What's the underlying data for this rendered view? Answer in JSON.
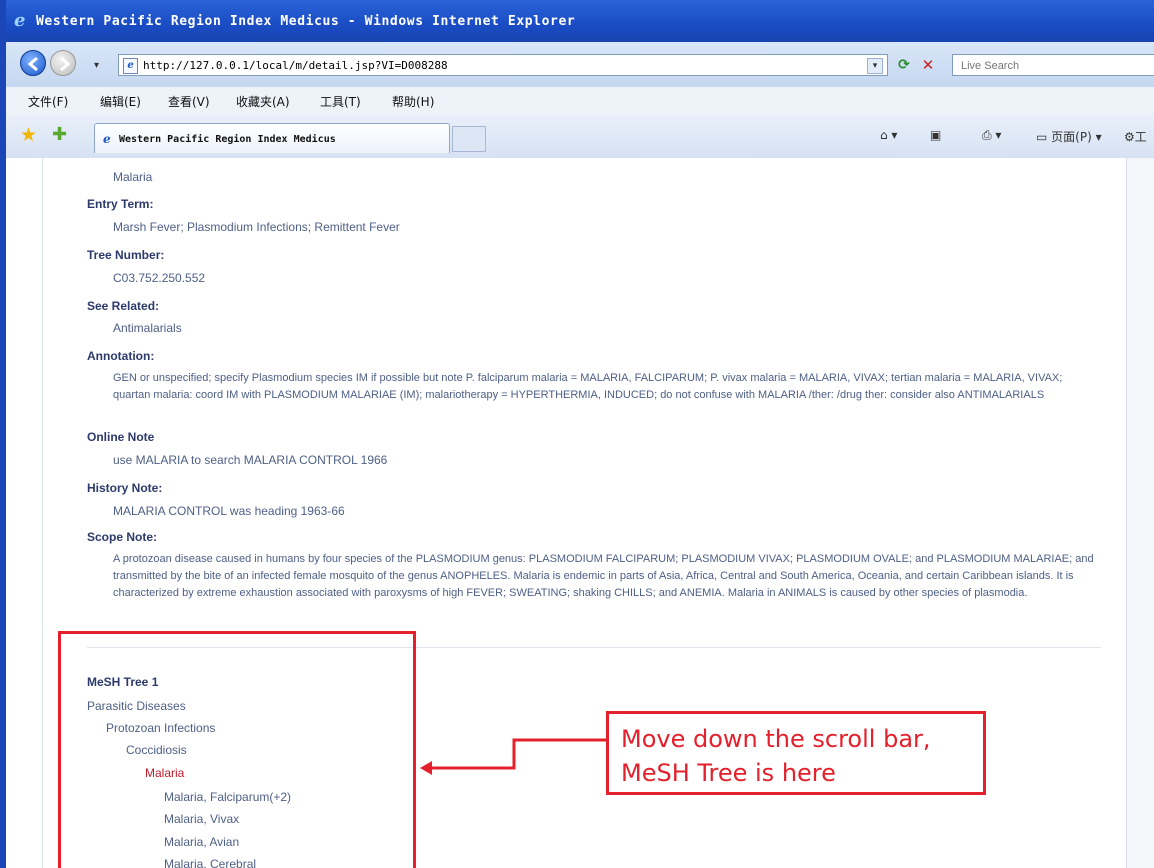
{
  "window": {
    "title": "Western Pacific Region Index Medicus - Windows Internet Explorer"
  },
  "address_bar": {
    "url": "http://127.0.0.1/local/m/detail.jsp?VI=D008288",
    "search_placeholder": "Live Search"
  },
  "menu": {
    "items": [
      "文件(F)",
      "编辑(E)",
      "查看(V)",
      "收藏夹(A)",
      "工具(T)",
      "帮助(H)"
    ]
  },
  "tabs": {
    "active_title": "Western Pacific Region Index Medicus",
    "tools": {
      "page_label": "页面(P)",
      "tools_label": "工"
    }
  },
  "record": {
    "heading_value": "Malaria",
    "entry_term_label": "Entry Term:",
    "entry_term_value": "Marsh Fever;  Plasmodium Infections;  Remittent Fever",
    "tree_number_label": "Tree Number:",
    "tree_number_value": "C03.752.250.552",
    "see_related_label": "See Related:",
    "see_related_value": "Antimalarials",
    "annotation_label": "Annotation:",
    "annotation_value": "GEN or unspecified; specify Plasmodium species IM if possible but note P. falciparum malaria = MALARIA, FALCIPARUM; P. vivax malaria = MALARIA, VIVAX; tertian malaria = MALARIA, VIVAX; quartan malaria: coord IM with PLASMODIUM MALARIAE (IM); malariotherapy = HYPERTHERMIA, INDUCED; do not confuse with MALARIA /ther: /drug ther: consider also ANTIMALARIALS",
    "online_note_label": "Online Note",
    "online_note_value": "use MALARIA to search MALARIA CONTROL 1966",
    "history_note_label": "History Note:",
    "history_note_value": "MALARIA CONTROL was heading 1963-66",
    "scope_note_label": "Scope Note:",
    "scope_note_value": "A protozoan disease caused in humans by four species of the PLASMODIUM genus: PLASMODIUM FALCIPARUM; PLASMODIUM VIVAX; PLASMODIUM OVALE; and PLASMODIUM MALARIAE; and transmitted by the bite of an infected female mosquito of the genus ANOPHELES. Malaria is endemic in parts of Asia, Africa, Central and South America, Oceania, and certain Caribbean islands. It is characterized by extreme exhaustion associated with paroxysms of high FEVER; SWEATING; shaking CHILLS; and ANEMIA. Malaria in ANIMALS is caused by other species of plasmodia."
  },
  "mesh_tree": {
    "title": "MeSH Tree 1",
    "nodes": [
      "Parasitic Diseases",
      "Protozoan Infections",
      "Coccidiosis",
      "Malaria",
      "Malaria, Falciparum(+2)",
      "Malaria, Vivax",
      "Malaria, Avian",
      "Malaria, Cerebral"
    ]
  },
  "callout": {
    "line1": "Move down the scroll bar,",
    "line2": "MeSH Tree is here"
  },
  "colors": {
    "annotation_red": "#e3202b",
    "label_blue": "#2b3a6a",
    "value_grey_blue": "#4e5f86",
    "titlebar_blue": "#1a4cc4"
  }
}
